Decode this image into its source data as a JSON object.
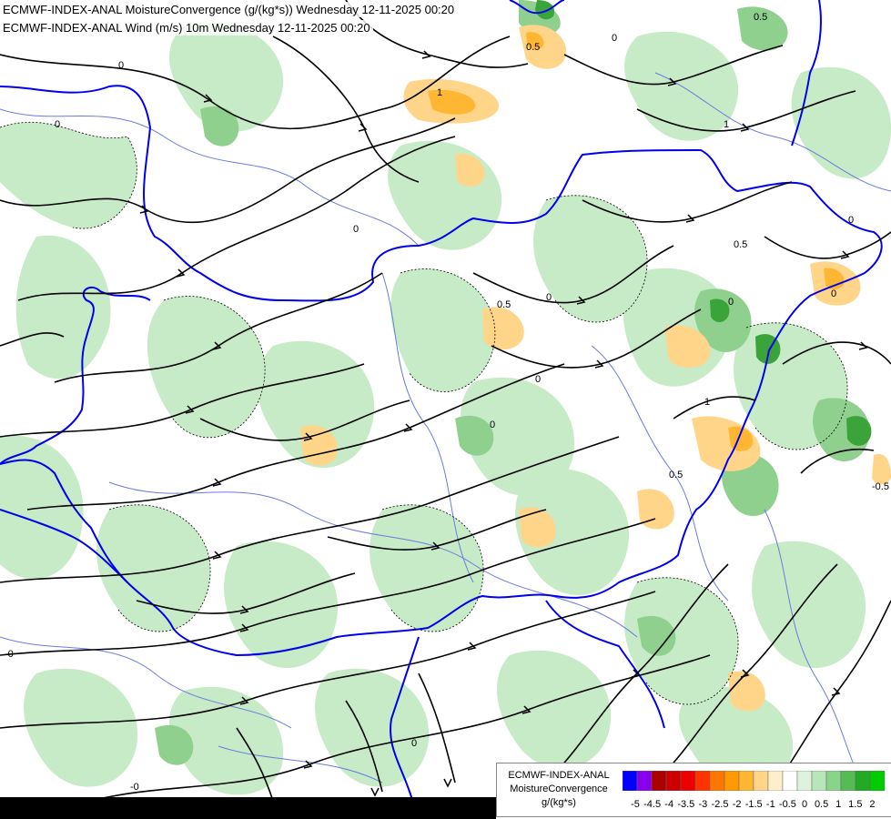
{
  "titles": {
    "line1": "ECMWF-INDEX-ANAL MoistureConvergence (g/(kg*s)) Wednesday 12-11-2025 00:20",
    "line2": "ECMWF-INDEX-ANAL Wind (m/s) 10m Wednesday 12-11-2025 00:20"
  },
  "legend": {
    "line1": "ECMWF-INDEX-ANAL",
    "line2": "MoistureConvergence",
    "line3": "g/(kg*s)",
    "swatch_colors": [
      "#0000ff",
      "#8800ee",
      "#aa0000",
      "#cc0000",
      "#ee0000",
      "#ff3300",
      "#ff7700",
      "#ff9900",
      "#ffb733",
      "#ffd58a",
      "#ffeecc",
      "#ffffff",
      "#ddf3dd",
      "#b8e6b8",
      "#88d488",
      "#55bb55",
      "#22aa22",
      "#00cc00"
    ],
    "ticks": [
      "-5",
      "-4.5",
      "-4",
      "-3.5",
      "-3",
      "-2.5",
      "-2",
      "-1.5",
      "-1",
      "-0.5",
      "0",
      "0.5",
      "1",
      "1.5",
      "2"
    ]
  },
  "contour_labels": [
    "0",
    "0",
    "0",
    "0",
    "0",
    "0",
    "0",
    "0",
    "0",
    "0",
    "0.5",
    "0.5",
    "0.5",
    "0.5",
    "1",
    "1",
    "1",
    "0.5",
    "0",
    "-0.5",
    "-0",
    "-0"
  ],
  "colors": {
    "border": "#0000ee",
    "river": "#6a7be0",
    "streamline": "#000000",
    "green_light": "#c6ebc6",
    "green_mid": "#8fd08f",
    "green_dark": "#3aa33a",
    "orange_light": "#ffd58a",
    "orange_mid": "#ffb733"
  }
}
